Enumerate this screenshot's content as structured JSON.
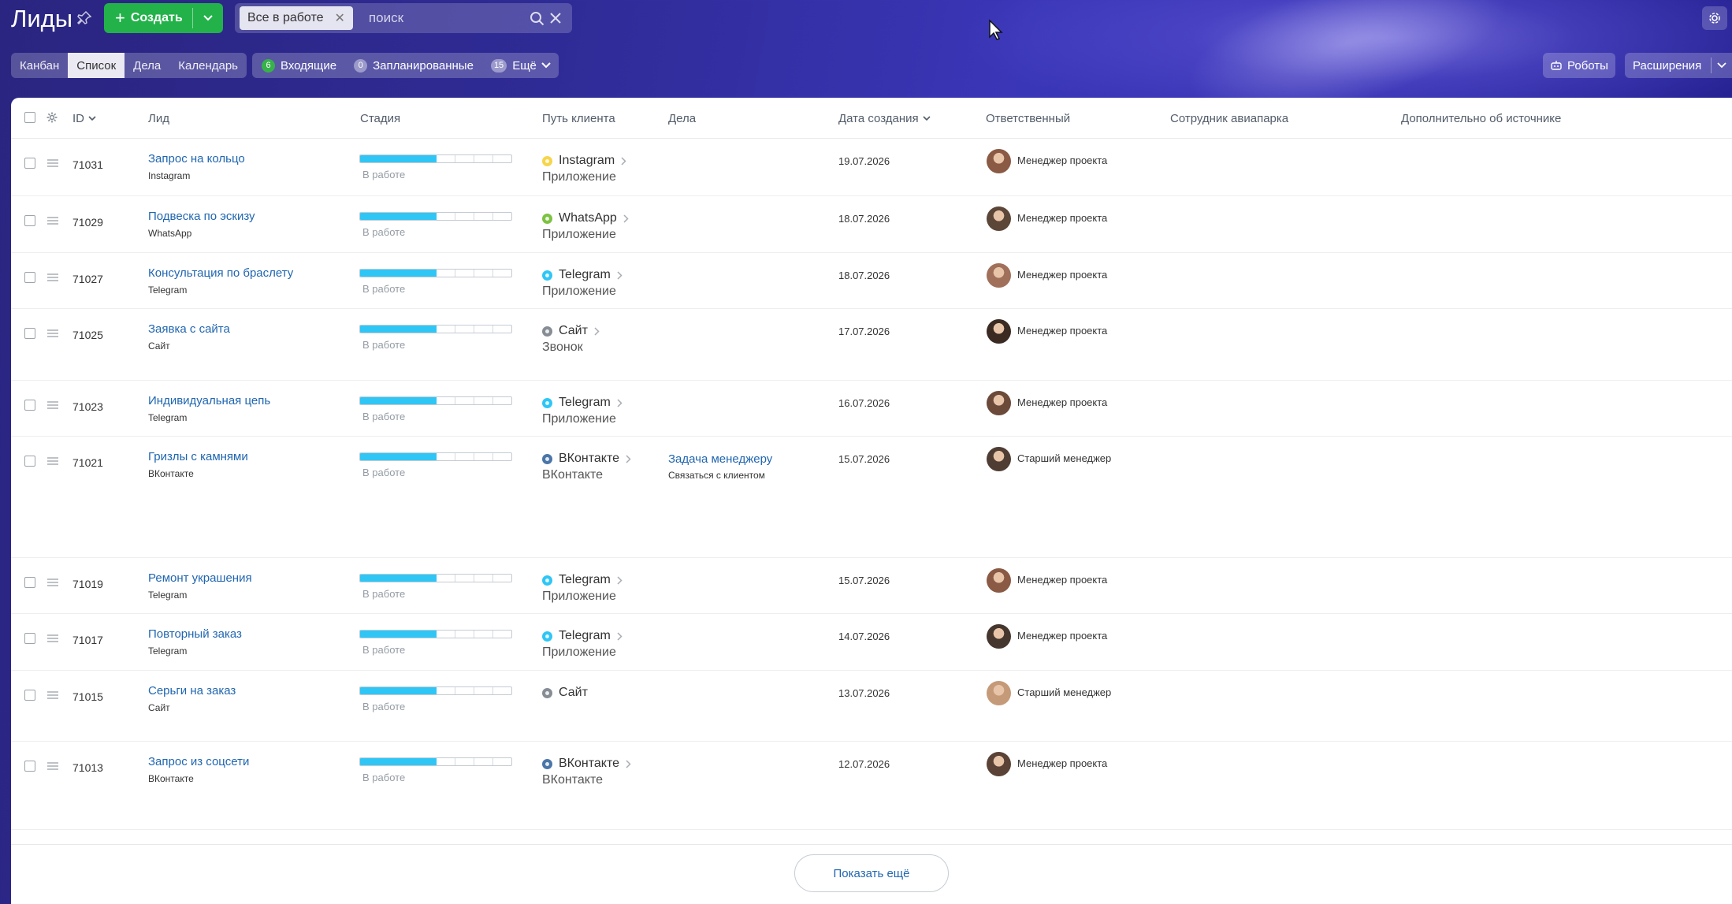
{
  "colors": {
    "accent_green": "#23b24a",
    "link_blue": "#2066b0",
    "stage_fill": "#2fc6f6",
    "background_purple": "#2f2b96"
  },
  "header": {
    "title": "Лиды",
    "create_label": "Создать",
    "filter_chip": "Все в работе",
    "search_placeholder": "поиск"
  },
  "views": {
    "tabs": [
      {
        "label": "Канбан",
        "active": false
      },
      {
        "label": "Список",
        "active": true
      },
      {
        "label": "Дела",
        "active": false
      },
      {
        "label": "Календарь",
        "active": false
      }
    ]
  },
  "counters": {
    "incoming": {
      "count": "6",
      "label": "Входящие"
    },
    "planned": {
      "count": "0",
      "label": "Запланированные"
    },
    "more": {
      "count": "15",
      "label": "Ещё"
    }
  },
  "toolbar": {
    "robots_label": "Роботы",
    "extensions_label": "Расширения"
  },
  "table": {
    "columns": {
      "id": "ID",
      "lead": "Лид",
      "stage": "Стадия",
      "path": "Путь клиента",
      "deals": "Дела",
      "created": "Дата создания",
      "responsible": "Ответственный",
      "aviapark": "Сотрудник авиапарка",
      "source_extra": "Дополнительно об источнике"
    },
    "stage_segments_filled": 4,
    "stage_segments_total": 8,
    "rows": [
      {
        "id": "71031",
        "title": "Запрос на кольцо",
        "source": "Instagram",
        "stage": "В работе",
        "path_channel": "Instagram",
        "path_color": "#f7d54a",
        "path_next": "Приложение",
        "deal_title": "",
        "deal_sub": "",
        "date": "19.07.2026",
        "responsible": "Менеджер проекта",
        "avatar_color": "#8a5a44"
      },
      {
        "id": "71029",
        "title": "Подвеска по эскизу",
        "source": "WhatsApp",
        "stage": "В работе",
        "path_channel": "WhatsApp",
        "path_color": "#7dc242",
        "path_next": "Приложение",
        "deal_title": "",
        "deal_sub": "",
        "date": "18.07.2026",
        "responsible": "Менеджер проекта",
        "avatar_color": "#5c4638"
      },
      {
        "id": "71027",
        "title": "Консультация по браслету",
        "source": "Telegram",
        "stage": "В работе",
        "path_channel": "Telegram",
        "path_color": "#2fc6f6",
        "path_next": "Приложение",
        "deal_title": "",
        "deal_sub": "",
        "date": "18.07.2026",
        "responsible": "Менеджер проекта",
        "avatar_color": "#a0705a"
      },
      {
        "id": "71025",
        "title": "Заявка с сайта",
        "source": "Сайт",
        "stage": "В работе",
        "path_channel": "Сайт",
        "path_color": "#868d95",
        "path_next": "Звонок",
        "deal_title": "",
        "deal_sub": "",
        "date": "17.07.2026",
        "responsible": "Менеджер проекта",
        "avatar_color": "#3a2a22"
      },
      {
        "id": "71023",
        "title": "Индивидуальная цепь",
        "source": "Telegram",
        "stage": "В работе",
        "path_channel": "Telegram",
        "path_color": "#2fc6f6",
        "path_next": "Приложение",
        "deal_title": "",
        "deal_sub": "",
        "date": "16.07.2026",
        "responsible": "Менеджер проекта",
        "avatar_color": "#6b4a3a"
      },
      {
        "id": "71021",
        "title": "Гризлы с камнями",
        "source": "ВКонтакте",
        "stage": "В работе",
        "path_channel": "ВКонтакте",
        "path_color": "#4a76a8",
        "path_next": "ВКонтакте",
        "deal_title": "Задача менеджеру",
        "deal_sub": "Связаться с клиентом",
        "date": "15.07.2026",
        "responsible": "Старший менеджер",
        "avatar_color": "#4f3d33"
      },
      {
        "id": "71019",
        "title": "Ремонт украшения",
        "source": "Telegram",
        "stage": "В работе",
        "path_channel": "Telegram",
        "path_color": "#2fc6f6",
        "path_next": "Приложение",
        "deal_title": "",
        "deal_sub": "",
        "date": "15.07.2026",
        "responsible": "Менеджер проекта",
        "avatar_color": "#8a5a44"
      },
      {
        "id": "71017",
        "title": "Повторный заказ",
        "source": "Telegram",
        "stage": "В работе",
        "path_channel": "Telegram",
        "path_color": "#2fc6f6",
        "path_next": "Приложение",
        "deal_title": "",
        "deal_sub": "",
        "date": "14.07.2026",
        "responsible": "Менеджер проекта",
        "avatar_color": "#45362e"
      },
      {
        "id": "71015",
        "title": "Серьги на заказ",
        "source": "Сайт",
        "stage": "В работе",
        "path_channel": "Сайт",
        "path_color": "#868d95",
        "path_next": "",
        "deal_title": "",
        "deal_sub": "",
        "date": "13.07.2026",
        "responsible": "Старший менеджер",
        "avatar_color": "#c59a78"
      },
      {
        "id": "71013",
        "title": "Запрос из соцсети",
        "source": "ВКонтакте",
        "stage": "В работе",
        "path_channel": "ВКонтакте",
        "path_color": "#4a76a8",
        "path_next": "ВКонтакте",
        "deal_title": "",
        "deal_sub": "",
        "date": "12.07.2026",
        "responsible": "Менеджер проекта",
        "avatar_color": "#5a4236"
      }
    ]
  },
  "footer": {
    "show_more_label": "Показать ещё"
  }
}
